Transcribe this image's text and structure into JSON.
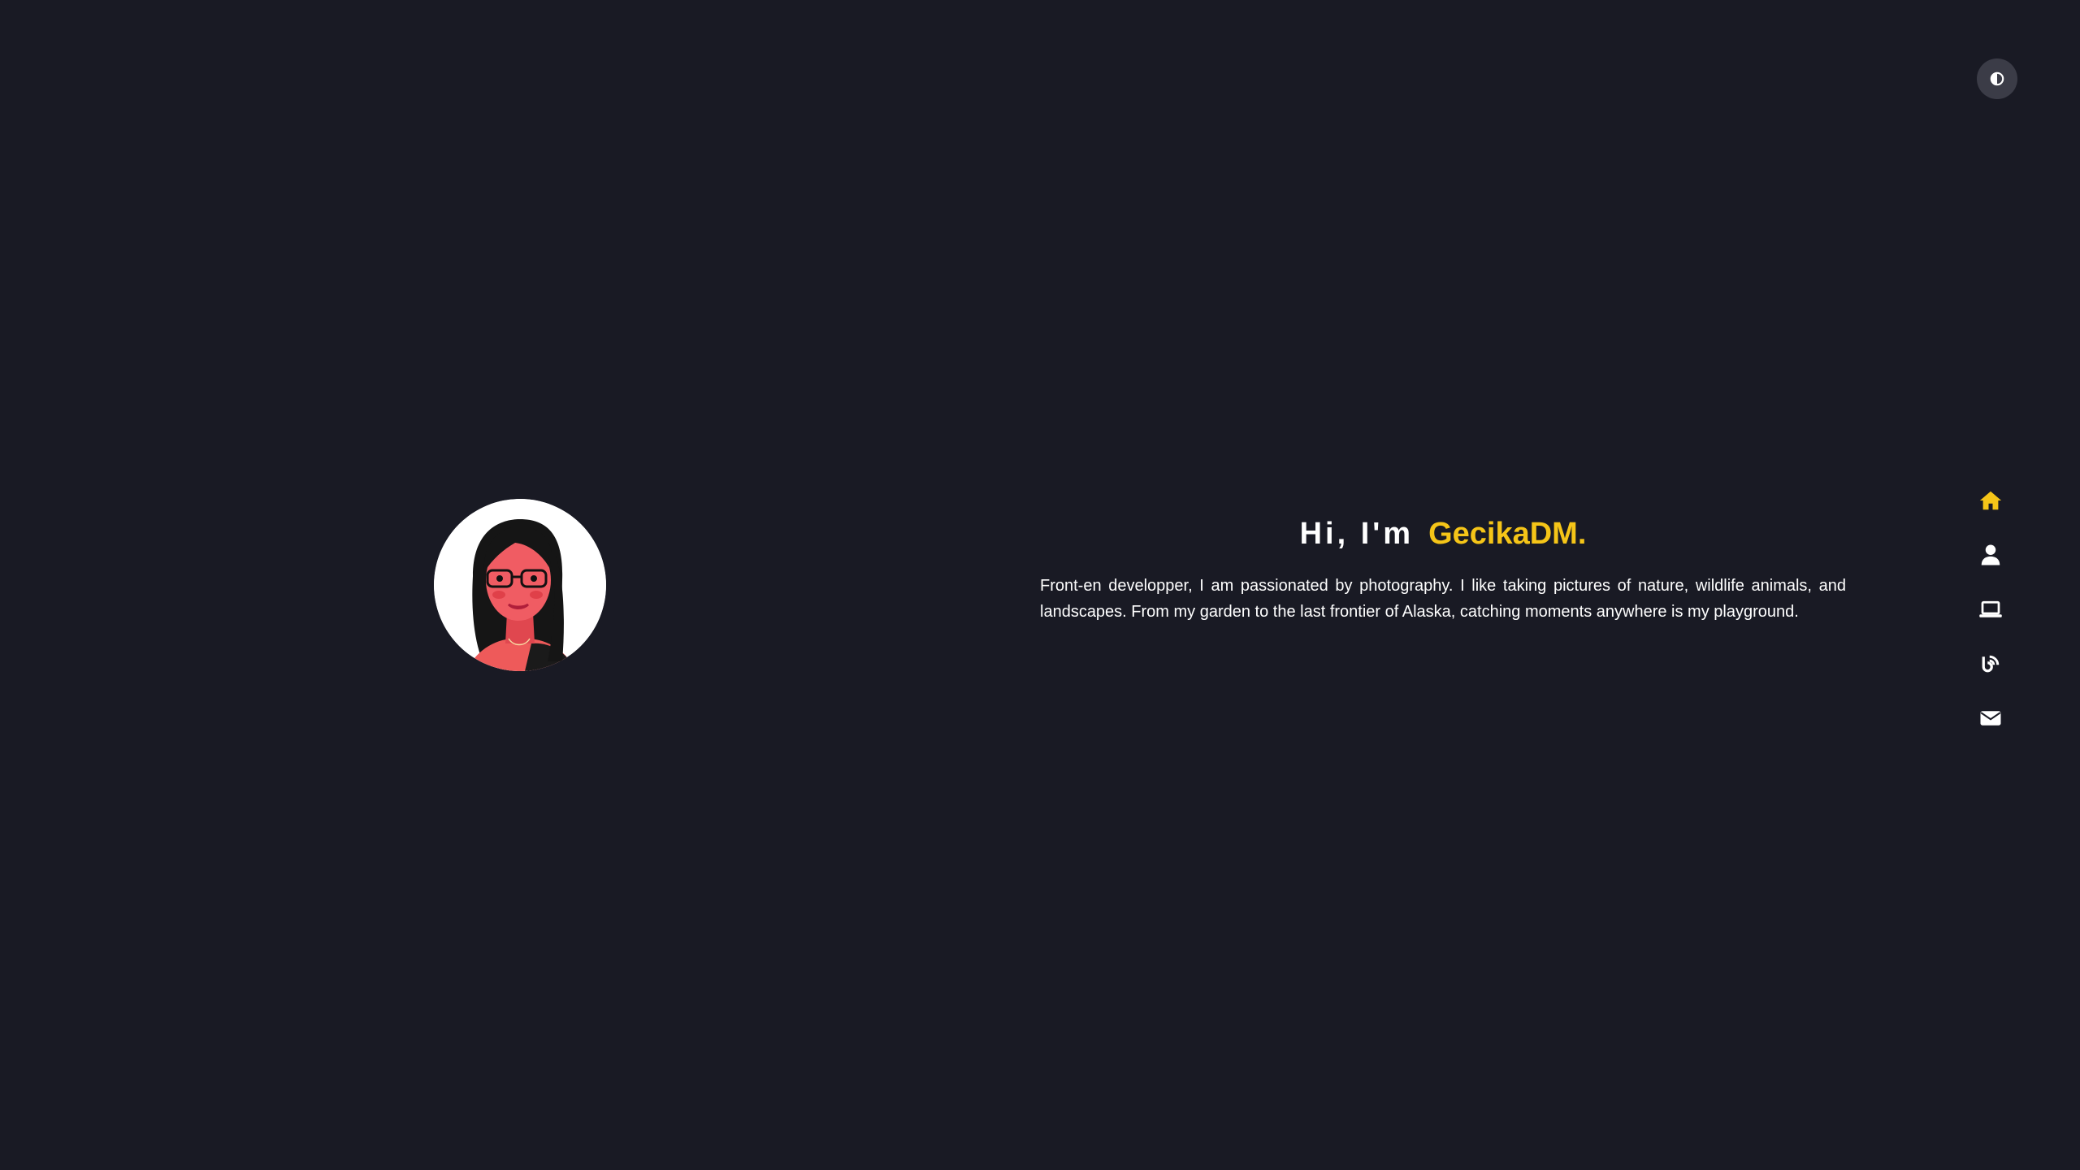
{
  "theme_toggle": {
    "icon": "contrast-icon"
  },
  "hero": {
    "greeting": "Hi, I'm",
    "name": "GecikaDM.",
    "description": "Front-en developper, I am passionated by photography. I like taking pictures of nature, wildlife animals, and landscapes. From my garden to the last frontier of Alaska, catching moments anywhere is my playground."
  },
  "nav": {
    "items": [
      {
        "icon": "home-icon",
        "active": true
      },
      {
        "icon": "user-icon",
        "active": false
      },
      {
        "icon": "laptop-icon",
        "active": false
      },
      {
        "icon": "blog-icon",
        "active": false
      },
      {
        "icon": "envelope-icon",
        "active": false
      }
    ]
  },
  "colors": {
    "background": "#191a24",
    "accent": "#f5c518",
    "text": "#ffffff",
    "toggle_bg": "#3b3c47"
  }
}
